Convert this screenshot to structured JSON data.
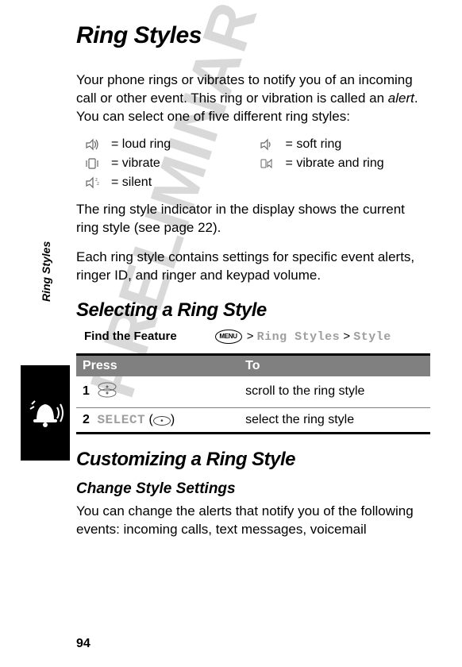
{
  "watermark": "PRELIMINARY",
  "side_tab": "Ring Styles",
  "page_number": "94",
  "title": "Ring Styles",
  "intro": {
    "lead": "Your phone rings or vibrates to notify you of an incoming call or other event. This ring or vibration is called an ",
    "alert_word": "alert",
    "tail": ". You can select one of five different ring styles:"
  },
  "styles": {
    "loud": "= loud ring",
    "soft": "= soft ring",
    "vibrate": "= vibrate",
    "vibring": "= vibrate and ring",
    "silent": "= silent"
  },
  "para_indicator": "The ring style indicator in the display shows the current ring style (see page 22).",
  "para_contains": "Each ring style contains settings for specific event alerts, ringer ID, and ringer and keypad volume.",
  "section_select": "Selecting a Ring Style",
  "feature": {
    "label": "Find the Feature",
    "menu_icon_label": "MENU",
    "gt1": ">",
    "path1": "Ring Styles",
    "gt2": ">",
    "path2": "Style"
  },
  "table": {
    "head_press": "Press",
    "head_to": "To",
    "rows": [
      {
        "num": "1",
        "press": "scroll-key",
        "select_label": "",
        "to": "scroll to the ring style"
      },
      {
        "num": "2",
        "press": "select-key",
        "select_label": "SELECT",
        "to": "select the ring style"
      }
    ]
  },
  "section_custom": "Customizing a Ring Style",
  "sub_change": "Change Style Settings",
  "para_change": "You can change the alerts that notify you of the following events: incoming calls, text messages, voicemail"
}
